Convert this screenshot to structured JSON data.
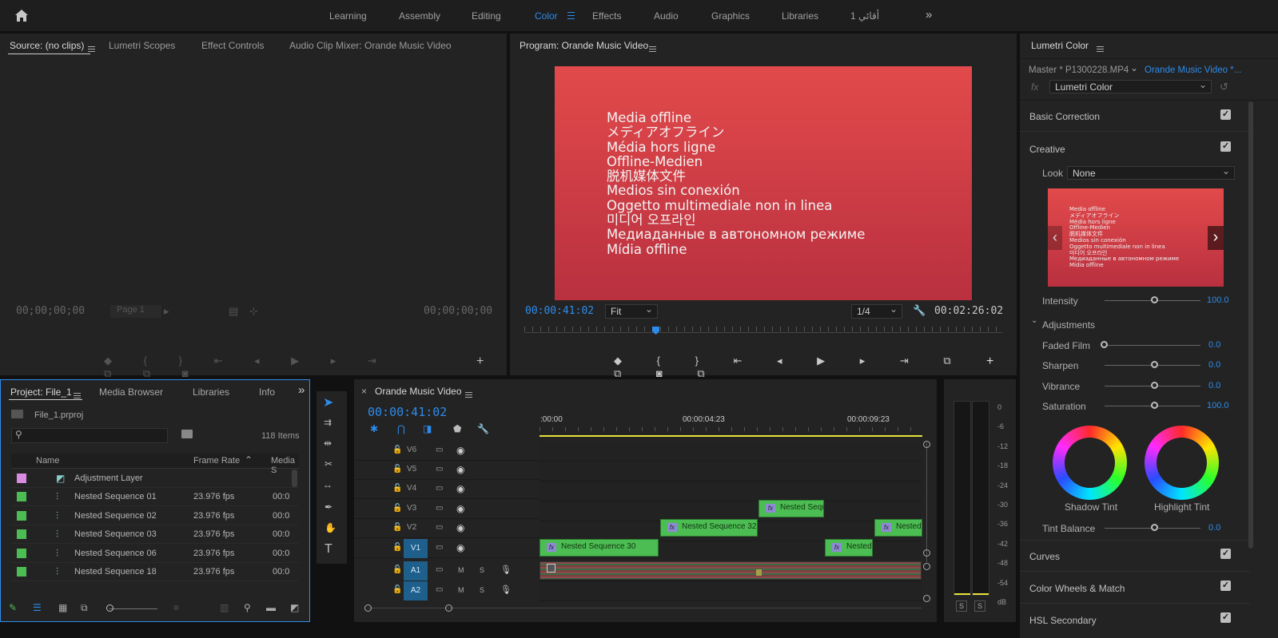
{
  "workspaces": [
    "Learning",
    "Assembly",
    "Editing",
    "Color",
    "Effects",
    "Audio",
    "Graphics",
    "Libraries",
    "أقائي 1"
  ],
  "active_workspace": "Color",
  "source_panel": {
    "tabs": [
      "Source: (no clips)",
      "Lumetri Scopes",
      "Effect Controls",
      "Audio Clip Mixer: Orande Music Video"
    ],
    "timecode_in": "00;00;00;00",
    "timecode_out": "00;00;00;00",
    "page": "Page 1"
  },
  "program_panel": {
    "title": "Program: Orande Music Video",
    "timecode": "00:00:41:02",
    "duration": "00:02:26:02",
    "fit": "Fit",
    "resolution": "1/4",
    "offline_lines": [
      "Media offline",
      "メディアオフライン",
      "Média hors ligne",
      "Offline-Medien",
      "脱机媒体文件",
      "Medios sin conexión",
      "Oggetto multimediale non in linea",
      "미디어 오프라인",
      "Медиаданные в автономном режиме",
      "Mídia offline"
    ]
  },
  "lumetri": {
    "title": "Lumetri Color",
    "master": "Master * P1300228.MP4",
    "sequence": "Orande Music Video *...",
    "effect": "Lumetri Color",
    "basic_correction": "Basic Correction",
    "creative": "Creative",
    "look_label": "Look",
    "look_value": "None",
    "intensity_label": "Intensity",
    "intensity_value": "100.0",
    "intensity": 1.0,
    "adjustments": "Adjustments",
    "faded_film_label": "Faded Film",
    "faded_film": "0.0",
    "sharpen_label": "Sharpen",
    "sharpen": "0.0",
    "vibrance_label": "Vibrance",
    "vibrance": "0.0",
    "saturation_label": "Saturation",
    "saturation": "100.0",
    "shadow_tint": "Shadow Tint",
    "highlight_tint": "Highlight Tint",
    "tint_balance_label": "Tint Balance",
    "tint_balance": "0.0",
    "curves": "Curves",
    "color_wheels": "Color Wheels & Match",
    "hsl": "HSL Secondary"
  },
  "project": {
    "tabs": [
      "Project: File_1",
      "Media Browser",
      "Libraries",
      "Info"
    ],
    "file": "File_1.prproj",
    "items_count": "118 Items",
    "columns": [
      "Name",
      "Frame Rate",
      "Media S"
    ],
    "rows": [
      {
        "name": "Adjustment Layer",
        "rate": "",
        "media": "",
        "color": "#d98be0"
      },
      {
        "name": "Nested Sequence 01",
        "rate": "23.976 fps",
        "media": "00:0",
        "color": "#4cbd52"
      },
      {
        "name": "Nested Sequence 02",
        "rate": "23.976 fps",
        "media": "00:0",
        "color": "#4cbd52"
      },
      {
        "name": "Nested Sequence 03",
        "rate": "23.976 fps",
        "media": "00:0",
        "color": "#4cbd52"
      },
      {
        "name": "Nested Sequence 06",
        "rate": "23.976 fps",
        "media": "00:0",
        "color": "#4cbd52"
      },
      {
        "name": "Nested Sequence 18",
        "rate": "23.976 fps",
        "media": "00:0",
        "color": "#4cbd52"
      }
    ]
  },
  "timeline": {
    "title": "Orande Music Video",
    "timecode": "00:00:41:02",
    "ruler": [
      ":00:00",
      "00:00:04:23",
      "00:00:09:23"
    ],
    "video_tracks": [
      "V6",
      "V5",
      "V4",
      "V3",
      "V2",
      "V1"
    ],
    "audio_tracks": [
      "A1",
      "A2"
    ],
    "clips": {
      "v3": "Nested Sequ",
      "v2a": "Nested Sequence 32",
      "v2b": "Nested",
      "v1a": "Nested Sequence 30",
      "v1b": "Nested"
    },
    "m": "M",
    "s": "S"
  },
  "meters": {
    "scale": [
      "0",
      "-6",
      "-12",
      "-18",
      "-24",
      "-30",
      "-36",
      "-42",
      "-48",
      "-54",
      "dB"
    ],
    "solo": "S"
  }
}
